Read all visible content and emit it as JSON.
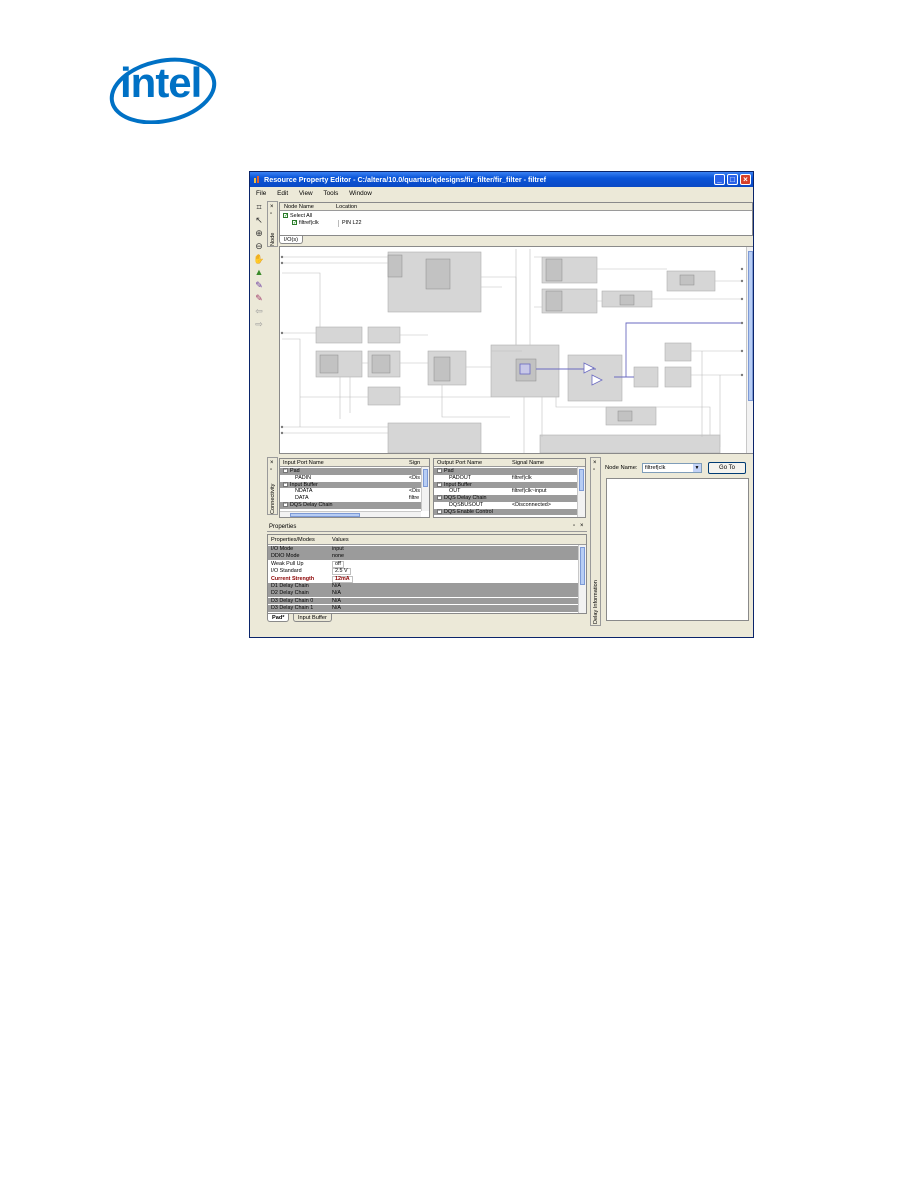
{
  "brand": {
    "logo_text": "intel"
  },
  "window": {
    "title": "Resource Property Editor - C:/altera/10.0/quartus/qdesigns/fir_filter/fir_filter - filtref",
    "menu": [
      "File",
      "Edit",
      "View",
      "Tools",
      "Window"
    ],
    "tools": [
      "select-region-icon",
      "pointer-icon",
      "zoom-in-icon",
      "zoom-out-icon",
      "hand-pan-icon",
      "find-icon",
      "edit-node-icon",
      "edit-node-2-icon",
      "back-icon",
      "forward-icon"
    ]
  },
  "node_panel": {
    "side_label": "Node",
    "columns": [
      "Node Name",
      "Location"
    ],
    "select_all": "Select All",
    "rows": [
      {
        "name": "filtref|clk",
        "location": "PIN L22"
      }
    ],
    "tab": "I/O(s)"
  },
  "connectivity": {
    "side_label": "Connectivity",
    "input": {
      "columns": [
        "Input Port Name",
        "Sign"
      ],
      "rows": [
        {
          "label": "Pad",
          "value": "",
          "indent": 0,
          "group": true
        },
        {
          "label": "PADIN",
          "value": "<Dis",
          "indent": 2,
          "group": false
        },
        {
          "label": "Input Buffer",
          "value": "",
          "indent": 0,
          "group": true
        },
        {
          "label": "NDATA",
          "value": "<Dis",
          "indent": 2,
          "group": false
        },
        {
          "label": "DATA",
          "value": "filtre",
          "indent": 2,
          "group": false
        },
        {
          "label": "DQS Delay Chain",
          "value": "",
          "indent": 0,
          "group": true
        }
      ]
    },
    "output": {
      "columns": [
        "Output Port Name",
        "Signal Name"
      ],
      "rows": [
        {
          "label": "Pad",
          "value": "",
          "indent": 0,
          "group": true
        },
        {
          "label": "PADOUT",
          "value": "filtref|clk",
          "indent": 2,
          "group": false
        },
        {
          "label": "Input Buffer",
          "value": "",
          "indent": 0,
          "group": true
        },
        {
          "label": "OUT",
          "value": "filtref|clk~input",
          "indent": 2,
          "group": false
        },
        {
          "label": "DQS Delay Chain",
          "value": "",
          "indent": 0,
          "group": true
        },
        {
          "label": "DQSBUSOUT",
          "value": "<Disconnected>",
          "indent": 2,
          "group": false
        },
        {
          "label": "DQS Enable Control",
          "value": "",
          "indent": 0,
          "group": true
        }
      ]
    }
  },
  "properties": {
    "title": "Properties",
    "columns": [
      "Properties/Modes",
      "Values"
    ],
    "rows": [
      {
        "name": "I/O Mode",
        "value": "input",
        "style": "dark"
      },
      {
        "name": "DDIO Mode",
        "value": "none",
        "style": "dark"
      },
      {
        "name": "Weak Pull Up",
        "value": "off",
        "style": "light"
      },
      {
        "name": "I/O Standard",
        "value": "2.5 V",
        "style": "light"
      },
      {
        "name": "Current Strength",
        "value": "12mA",
        "style": "highlight"
      },
      {
        "name": "D1 Delay Chain",
        "value": "N/A",
        "style": "dark"
      },
      {
        "name": "D2 Delay Chain",
        "value": "N/A",
        "style": "dark"
      },
      {
        "name": "D3 Delay Chain 0",
        "value": "N/A",
        "style": "dark"
      },
      {
        "name": "D3 Delay Chain 1",
        "value": "N/A",
        "style": "dark"
      }
    ],
    "tabs": [
      "Pad*",
      "Input Buffer"
    ]
  },
  "delay": {
    "side_label": "Delay Information",
    "node_name_label": "Node Name:",
    "node_name_value": "filtref|clk",
    "go_button": "Go To"
  }
}
